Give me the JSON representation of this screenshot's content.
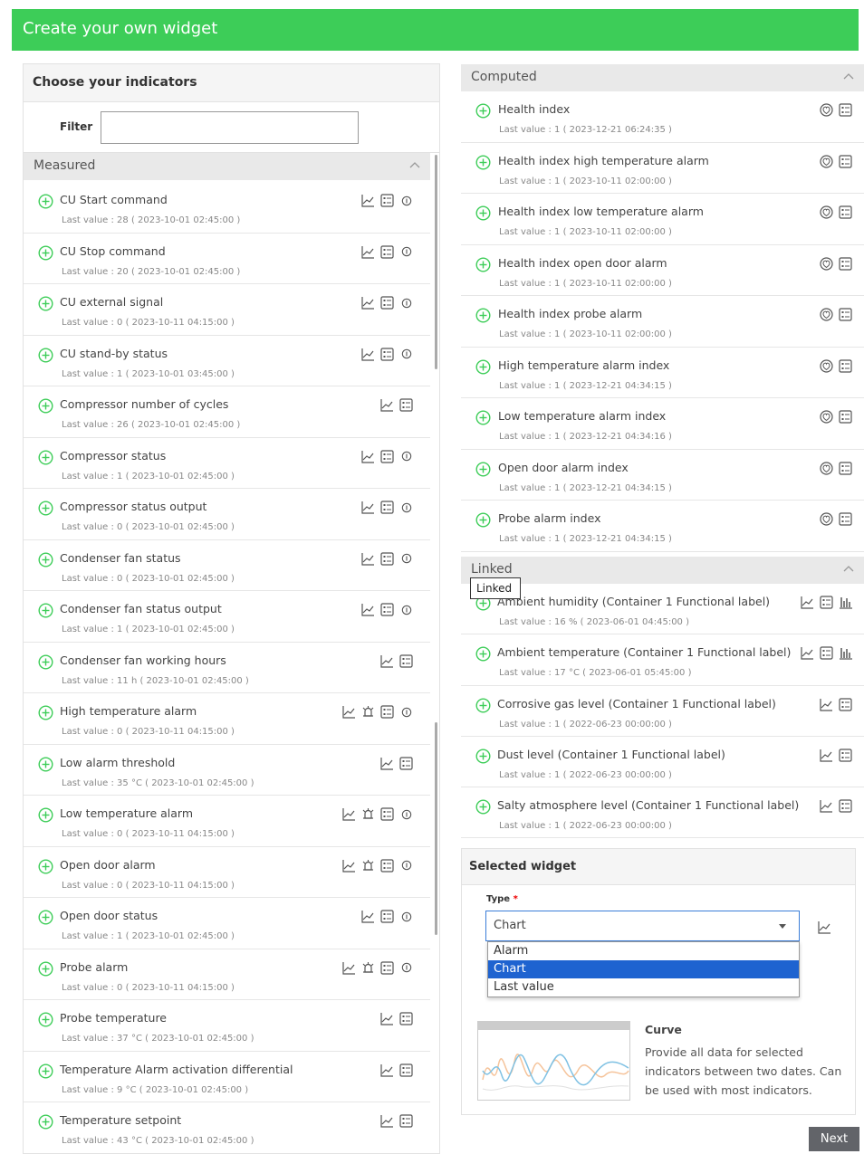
{
  "header": {
    "title": "Create your own widget"
  },
  "left": {
    "title": "Choose your indicators",
    "filter_label": "Filter",
    "filter_value": "",
    "measured_label": "Measured",
    "items": [
      {
        "name": "CU Start command",
        "last": "Last value : 28 ( 2023-10-01 02:45:00 )",
        "icons": [
          "chart",
          "table",
          "info"
        ]
      },
      {
        "name": "CU Stop command",
        "last": "Last value : 20 ( 2023-10-01 02:45:00 )",
        "icons": [
          "chart",
          "table",
          "info"
        ]
      },
      {
        "name": "CU external signal",
        "last": "Last value : 0 ( 2023-10-11 04:15:00 )",
        "icons": [
          "chart",
          "table",
          "info"
        ]
      },
      {
        "name": "CU stand-by status",
        "last": "Last value : 1 ( 2023-10-01 03:45:00 )",
        "icons": [
          "chart",
          "table",
          "info"
        ]
      },
      {
        "name": "Compressor number of cycles",
        "last": "Last value : 26 ( 2023-10-01 02:45:00 )",
        "icons": [
          "chart",
          "table"
        ]
      },
      {
        "name": "Compressor status",
        "last": "Last value : 1 ( 2023-10-01 02:45:00 )",
        "icons": [
          "chart",
          "table",
          "info"
        ]
      },
      {
        "name": "Compressor status output",
        "last": "Last value : 0 ( 2023-10-01 02:45:00 )",
        "icons": [
          "chart",
          "table",
          "info"
        ]
      },
      {
        "name": "Condenser fan status",
        "last": "Last value : 0 ( 2023-10-01 02:45:00 )",
        "icons": [
          "chart",
          "table",
          "info"
        ]
      },
      {
        "name": "Condenser fan status output",
        "last": "Last value : 1 ( 2023-10-01 02:45:00 )",
        "icons": [
          "chart",
          "table",
          "info"
        ]
      },
      {
        "name": "Condenser fan working hours",
        "last": "Last value : 11 h ( 2023-10-01 02:45:00 )",
        "icons": [
          "chart",
          "table"
        ]
      },
      {
        "name": "High temperature alarm",
        "last": "Last value : 0 ( 2023-10-11 04:15:00 )",
        "icons": [
          "chart",
          "alarm",
          "table",
          "info"
        ]
      },
      {
        "name": "Low alarm threshold",
        "last": "Last value : 35 °C ( 2023-10-01 02:45:00 )",
        "icons": [
          "chart",
          "table"
        ]
      },
      {
        "name": "Low temperature alarm",
        "last": "Last value : 0 ( 2023-10-11 04:15:00 )",
        "icons": [
          "chart",
          "alarm",
          "table",
          "info"
        ]
      },
      {
        "name": "Open door alarm",
        "last": "Last value : 0 ( 2023-10-11 04:15:00 )",
        "icons": [
          "chart",
          "alarm",
          "table",
          "info"
        ]
      },
      {
        "name": "Open door status",
        "last": "Last value : 1 ( 2023-10-01 02:45:00 )",
        "icons": [
          "chart",
          "table",
          "info"
        ]
      },
      {
        "name": "Probe alarm",
        "last": "Last value : 0 ( 2023-10-11 04:15:00 )",
        "icons": [
          "chart",
          "alarm",
          "table",
          "info"
        ]
      },
      {
        "name": "Probe temperature",
        "last": "Last value : 37 °C ( 2023-10-01 02:45:00 )",
        "icons": [
          "chart",
          "table"
        ]
      },
      {
        "name": "Temperature Alarm activation differential",
        "last": "Last value : 9 °C ( 2023-10-01 02:45:00 )",
        "icons": [
          "chart",
          "table"
        ]
      },
      {
        "name": "Temperature setpoint",
        "last": "Last value : 43 °C ( 2023-10-01 02:45:00 )",
        "icons": [
          "chart",
          "table"
        ]
      }
    ]
  },
  "computed": {
    "label": "Computed",
    "items": [
      {
        "name": "Health index",
        "last": "Last value : 1 ( 2023-12-21 06:24:35 )"
      },
      {
        "name": "Health index high temperature alarm",
        "last": "Last value : 1 ( 2023-10-11 02:00:00 )"
      },
      {
        "name": "Health index low temperature alarm",
        "last": "Last value : 1 ( 2023-10-11 02:00:00 )"
      },
      {
        "name": "Health index open door alarm",
        "last": "Last value : 1 ( 2023-10-11 02:00:00 )"
      },
      {
        "name": "Health index probe alarm",
        "last": "Last value : 1 ( 2023-10-11 02:00:00 )"
      },
      {
        "name": "High temperature alarm index",
        "last": "Last value : 1 ( 2023-12-21 04:34:15 )"
      },
      {
        "name": "Low temperature alarm index",
        "last": "Last value : 1 ( 2023-12-21 04:34:16 )"
      },
      {
        "name": "Open door alarm index",
        "last": "Last value : 1 ( 2023-12-21 04:34:15 )"
      },
      {
        "name": "Probe alarm index",
        "last": "Last value : 1 ( 2023-12-21 04:34:15 )"
      }
    ]
  },
  "linked": {
    "label": "Linked",
    "tooltip": "Linked",
    "items": [
      {
        "name": "Ambient humidity (Container 1 Functional label)",
        "last": "Last value : 16 % ( 2023-06-01 04:45:00 )",
        "icons": [
          "chart",
          "table",
          "bars"
        ]
      },
      {
        "name": "Ambient temperature (Container 1 Functional label)",
        "last": "Last value : 17 °C ( 2023-06-01 05:45:00 )",
        "icons": [
          "chart",
          "table",
          "bars"
        ]
      },
      {
        "name": "Corrosive gas level (Container 1 Functional label)",
        "last": "Last value : 1 ( 2022-06-23 00:00:00 )",
        "icons": [
          "chart",
          "table"
        ]
      },
      {
        "name": "Dust level (Container 1 Functional label)",
        "last": "Last value : 1 ( 2022-06-23 00:00:00 )",
        "icons": [
          "chart",
          "table"
        ]
      },
      {
        "name": "Salty atmosphere level (Container 1 Functional label)",
        "last": "Last value : 1 ( 2022-06-23 00:00:00 )",
        "icons": [
          "chart",
          "table"
        ]
      }
    ]
  },
  "selected": {
    "title": "Selected widget",
    "type_label": "Type",
    "required_mark": "*",
    "type_value": "Chart",
    "options": [
      "Alarm",
      "Chart",
      "Last value"
    ],
    "selected_option": "Chart",
    "curve_title": "Curve",
    "curve_desc": "Provide all data for selected indicators between two dates. Can be used with most indicators."
  },
  "next_label": "Next",
  "colors": {
    "accent": "#3dcd58",
    "selected": "#1e63d0",
    "button": "#626469"
  }
}
